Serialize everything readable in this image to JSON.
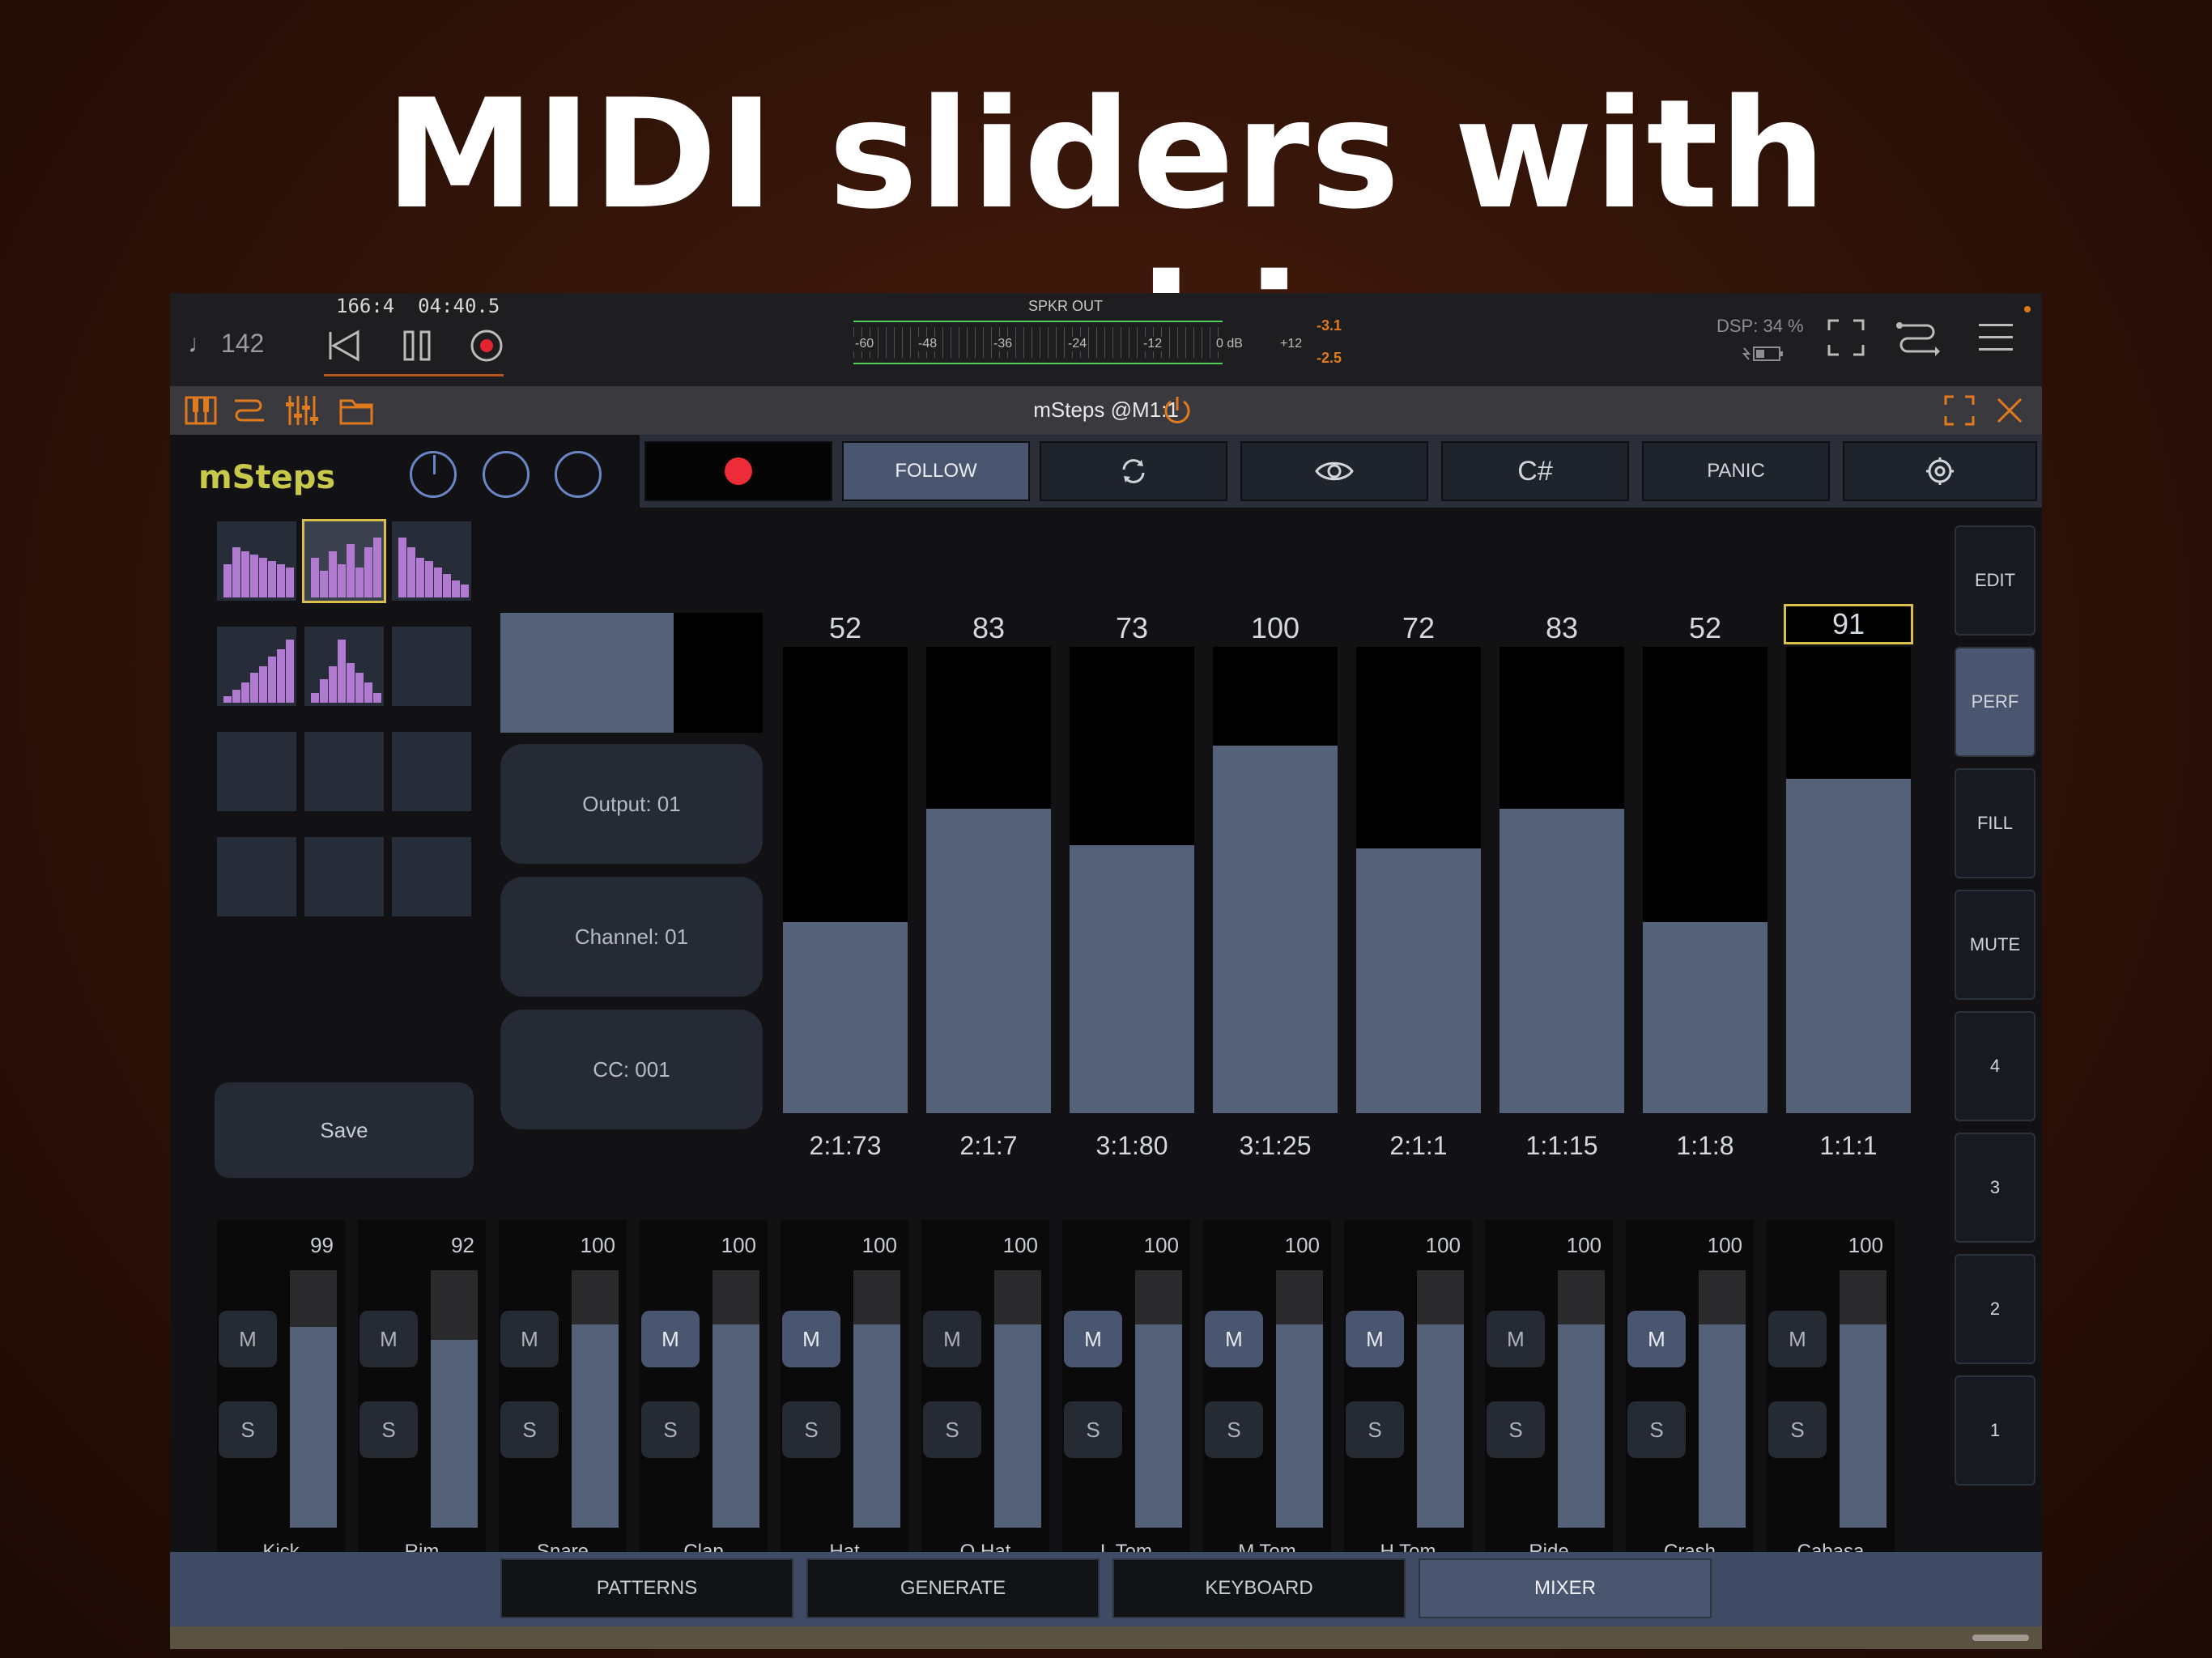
{
  "headline": "MIDI sliders with morphing",
  "host": {
    "tempo": "♩ 142",
    "position": "166:4",
    "time": "04:40.5",
    "meter_title": "SPKR OUT",
    "meter_labels": [
      "-60",
      "-48",
      "-36",
      "-24",
      "-12",
      "0 dB",
      "+12"
    ],
    "peak_top": "-3.1",
    "peak_bottom": "-2.5",
    "dsp": "DSP: 34 %"
  },
  "plugin": {
    "title": "mSteps @M1:1",
    "logo": "mSteps",
    "top_buttons": [
      "",
      "FOLLOW",
      "",
      "",
      "C#",
      "PANIC",
      ""
    ],
    "preview_fill": 0.66,
    "midi": [
      "Output: 01",
      "Channel: 01",
      "CC: 001"
    ],
    "save": "Save",
    "sliders": [
      {
        "value": "52",
        "pos": "2:1:73",
        "level": 52
      },
      {
        "value": "83",
        "pos": "2:1:7",
        "level": 83
      },
      {
        "value": "73",
        "pos": "3:1:80",
        "level": 73
      },
      {
        "value": "100",
        "pos": "3:1:25",
        "level": 100
      },
      {
        "value": "72",
        "pos": "2:1:1",
        "level": 72
      },
      {
        "value": "83",
        "pos": "1:1:15",
        "level": 83
      },
      {
        "value": "52",
        "pos": "1:1:8",
        "level": 52
      },
      {
        "value": "91",
        "pos": "1:1:1",
        "level": 91
      }
    ],
    "side_buttons": [
      "EDIT",
      "PERF",
      "FILL",
      "MUTE",
      "4",
      "3",
      "2",
      "1"
    ],
    "mixer": [
      {
        "name": "Kick",
        "vol": "99",
        "level": 0.78,
        "m_on": false,
        "color": "#e8646a"
      },
      {
        "name": "Rim",
        "vol": "92",
        "level": 0.73,
        "m_on": false,
        "color": "#3fc5b4"
      },
      {
        "name": "Snare",
        "vol": "100",
        "level": 0.79,
        "m_on": false,
        "color": "#8b8f98"
      },
      {
        "name": "Clap",
        "vol": "100",
        "level": 0.79,
        "m_on": true,
        "color": "#b6c33a"
      },
      {
        "name": "Hat",
        "vol": "100",
        "level": 0.79,
        "m_on": true,
        "color": "#7c74d8"
      },
      {
        "name": "O Hat",
        "vol": "100",
        "level": 0.79,
        "m_on": false,
        "color": "#e86a3a"
      },
      {
        "name": "L Tom",
        "vol": "100",
        "level": 0.79,
        "m_on": true,
        "color": "#3ab8d8"
      },
      {
        "name": "M Tom",
        "vol": "100",
        "level": 0.79,
        "m_on": true,
        "color": "#9aa0aa"
      },
      {
        "name": "H Tom",
        "vol": "100",
        "level": 0.79,
        "m_on": true,
        "color": "#3fc56a"
      },
      {
        "name": "Ride",
        "vol": "100",
        "level": 0.79,
        "m_on": false,
        "color": "#c05ad0"
      },
      {
        "name": "Crash",
        "vol": "100",
        "level": 0.79,
        "m_on": true,
        "color": "#d8a020"
      },
      {
        "name": "Cabasa",
        "vol": "100",
        "level": 0.79,
        "m_on": false,
        "color": "#4a8ee8"
      }
    ],
    "mute_label": "M",
    "solo_label": "S",
    "tabs": [
      "PATTERNS",
      "GENERATE",
      "KEYBOARD",
      "MIXER"
    ]
  }
}
